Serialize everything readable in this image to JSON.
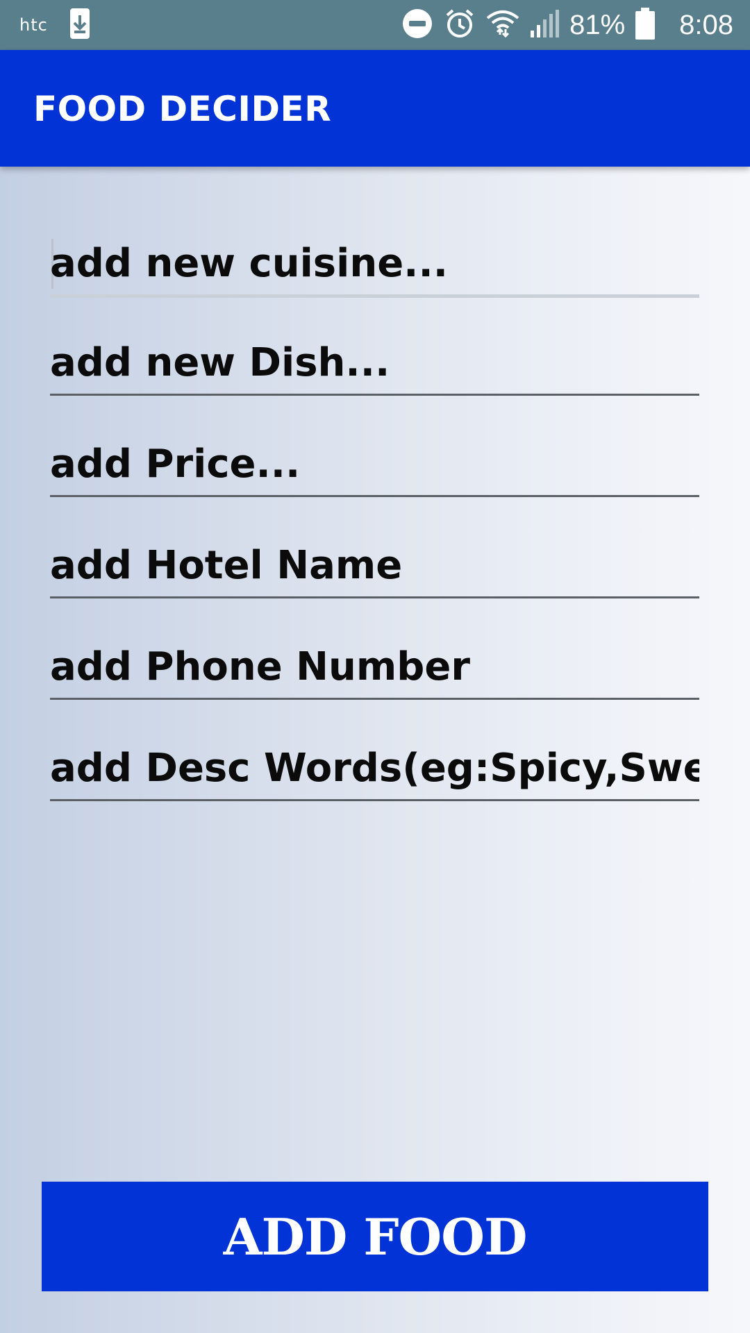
{
  "status_bar": {
    "brand": "htc",
    "battery_percent": "81%",
    "time": "8:08",
    "icons": [
      "download-icon",
      "dnd-icon",
      "alarm-icon",
      "wifi-icon",
      "signal-icon",
      "battery-icon"
    ],
    "background": "#5a7f8c"
  },
  "app_bar": {
    "title": "FOOD DECIDER",
    "background": "#0233d6"
  },
  "form": {
    "fields": [
      {
        "text": "add new cuisine...",
        "focused": true
      },
      {
        "text": "add new Dish..."
      },
      {
        "text": "add Price..."
      },
      {
        "text": "add Hotel Name"
      },
      {
        "text": "add Phone Number"
      },
      {
        "text": "add Desc Words(eg:Spicy,Sweet,"
      }
    ]
  },
  "button": {
    "label": "ADD FOOD",
    "background": "#0233d6"
  }
}
